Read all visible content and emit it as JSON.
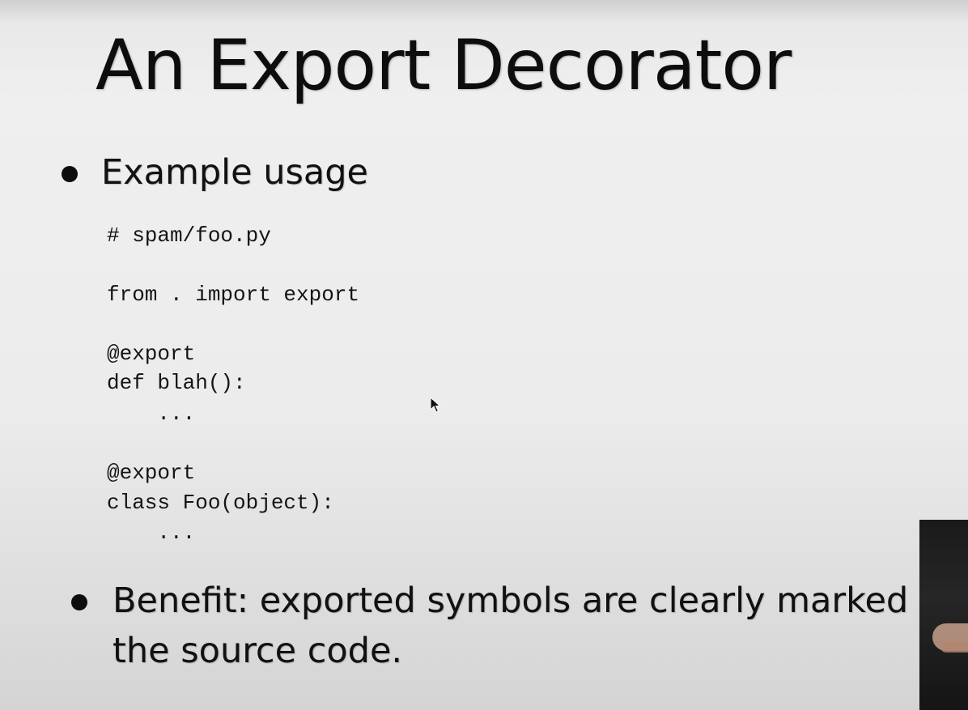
{
  "slide": {
    "title": "An Export Decorator",
    "bullets": [
      {
        "text": "Example usage"
      },
      {
        "lines": [
          "Benefit: exported symbols are clearly marked in",
          "the source code."
        ]
      }
    ],
    "code": [
      "# spam/foo.py",
      "from . import export",
      "@export",
      "def blah():",
      "    ...",
      "@export",
      "class Foo(object):",
      "    ..."
    ]
  },
  "colors": {
    "text": "#111111",
    "background": "#ececec",
    "webcam": "#1a1a1a"
  },
  "icons": {
    "cursor": "mouse-pointer-icon"
  }
}
